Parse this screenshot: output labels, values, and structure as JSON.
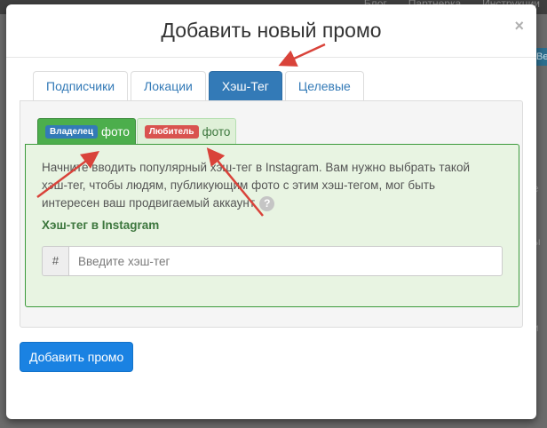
{
  "background": {
    "top_nav": [
      "Блог",
      "Партнерка",
      "Инструкции"
    ],
    "right_edge_texts": [
      "е",
      "ы",
      "и"
    ],
    "right_badge": "Ве"
  },
  "modal": {
    "title": "Добавить новый промо",
    "close_glyph": "×",
    "tabs": [
      {
        "label": "Подписчики",
        "active": false
      },
      {
        "label": "Локации",
        "active": false
      },
      {
        "label": "Хэш-Тег",
        "active": true
      },
      {
        "label": "Целевые",
        "active": false
      }
    ],
    "subtabs": {
      "owner": {
        "badge": "Владелец",
        "suffix": "фото",
        "active": true
      },
      "fan": {
        "badge": "Любитель",
        "suffix": "фото",
        "active": false
      }
    },
    "description": "Начните вводить популярный хэш-тег в Instagram. Вам нужно выбрать такой хэш-тег, чтобы людям, публикующим фото с этим хэш-тегом, мог быть интересен ваш продвигаемый аккаунт.",
    "help_glyph": "?",
    "field": {
      "label": "Хэш-тег в Instagram",
      "addon": "#",
      "value": "",
      "placeholder": "Введите хэш-тег"
    },
    "submit_label": "Добавить промо"
  },
  "colors": {
    "primary": "#337ab7",
    "submit": "#1a82e2",
    "success": "#4cae4c",
    "danger": "#d9534f",
    "annotation_arrow": "#d9433a"
  }
}
